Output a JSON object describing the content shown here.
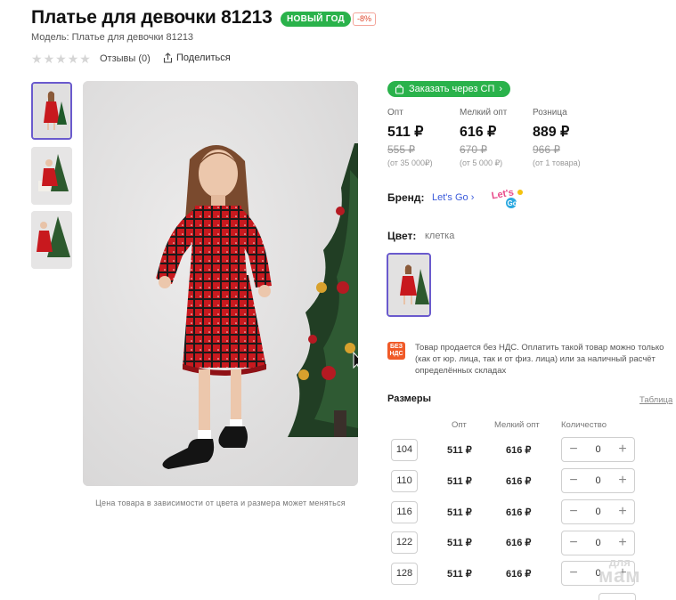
{
  "product": {
    "title": "Платье для девочки 81213",
    "badge_new_year": "НОВЫЙ ГОД",
    "badge_discount": "-8%",
    "model": "Модель: Платье для девочки 81213",
    "reviews": "Отзывы (0)",
    "share": "Поделиться",
    "price_note": "Цена товара в зависимости от цвета и размера может меняться"
  },
  "order_button": "Заказать через СП",
  "prices": [
    {
      "type": "Опт",
      "price": "511 ₽",
      "old": "555 ₽",
      "from": "(от 35 000₽)"
    },
    {
      "type": "Мелкий опт",
      "price": "616 ₽",
      "old": "670 ₽",
      "from": "(от 5 000 ₽)"
    },
    {
      "type": "Розница",
      "price": "889 ₽",
      "old": "966 ₽",
      "from": "(от 1 товара)"
    }
  ],
  "brand": {
    "label": "Бренд:",
    "value": "Let's Go",
    "logo_text": "Let's Go"
  },
  "color": {
    "label": "Цвет:",
    "value": "клетка"
  },
  "nds": {
    "icon_line1": "БЕЗ",
    "icon_line2": "НДС",
    "text": "Товар продается без НДС. Оплатить такой товар можно только (как от юр. лица, так и от физ. лица) или за наличный расчёт определённых складах"
  },
  "sizes": {
    "label": "Размеры",
    "table_link": "Таблица",
    "headers": {
      "opt": "Опт",
      "small_opt": "Мелкий опт",
      "qty": "Количество"
    },
    "rows": [
      {
        "size": "104",
        "opt": "511 ₽",
        "small_opt": "616 ₽",
        "qty": "0"
      },
      {
        "size": "110",
        "opt": "511 ₽",
        "small_opt": "616 ₽",
        "qty": "0"
      },
      {
        "size": "116",
        "opt": "511 ₽",
        "small_opt": "616 ₽",
        "qty": "0"
      },
      {
        "size": "122",
        "opt": "511 ₽",
        "small_opt": "616 ₽",
        "qty": "0"
      },
      {
        "size": "128",
        "opt": "511 ₽",
        "small_opt": "616 ₽",
        "qty": "0"
      }
    ]
  },
  "watermark": {
    "line1": "для",
    "line2": "мам"
  },
  "colors": {
    "green": "#2ab24b",
    "accent": "#6a5acd",
    "link": "#3b5bdb",
    "dress_red": "#c8191e"
  }
}
